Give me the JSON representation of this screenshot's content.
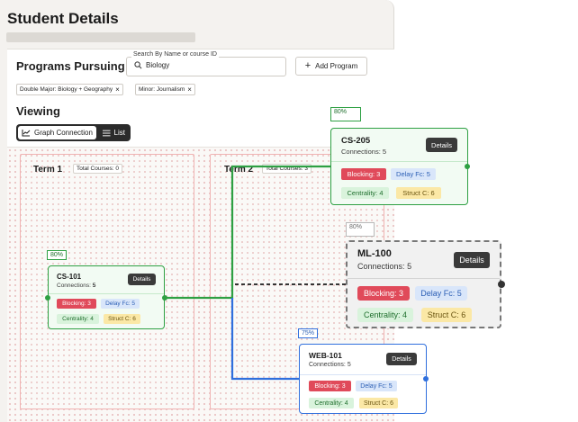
{
  "page": {
    "title": "Student Details"
  },
  "programs": {
    "title": "Programs Pursuing",
    "search": {
      "caption": "Search By Name or course ID",
      "value": "Biology",
      "placeholder": ""
    },
    "add_button": "Add Program",
    "chips": [
      "Double Major: Biology + Geography",
      "Minor: Journalism"
    ]
  },
  "viewing": {
    "title": "Viewing",
    "options": [
      "Graph Connection",
      "List"
    ],
    "selected": "Graph Connection"
  },
  "terms": [
    {
      "label": "Term 1",
      "count": "Total Courses: 0"
    },
    {
      "label": "Term 2",
      "count": "Total Courses: 3"
    }
  ],
  "courses": {
    "cs101": {
      "pct": "80%",
      "title": "CS-101",
      "connections_label": "Connections:",
      "connections": "5",
      "details": "Details",
      "tags": [
        "Blocking: 3",
        "Delay Fc: 5",
        "Centrality: 4",
        "Struct C: 6"
      ]
    },
    "cs205": {
      "pct": "80%",
      "title": "CS-205",
      "connections_label": "Connections:",
      "connections": "5",
      "details": "Details",
      "tags": [
        "Blocking: 3",
        "Delay Fc: 5",
        "Centrality: 4",
        "Struct C: 6"
      ]
    },
    "ml100": {
      "pct": "80%",
      "title": "ML-100",
      "connections_label": "Connections:",
      "connections": "5",
      "details": "Details",
      "tags": [
        "Blocking: 3",
        "Delay Fc: 5",
        "Centrality: 4",
        "Struct C: 6"
      ]
    },
    "web101": {
      "pct": "75%",
      "title": "WEB-101",
      "connections_label": "Connections:",
      "connections": "5",
      "details": "Details",
      "tags": [
        "Blocking: 3",
        "Delay Fc: 5",
        "Centrality: 4",
        "Struct C: 6"
      ]
    }
  },
  "colors": {
    "green": "#2ea043",
    "blue": "#2f6fdd",
    "dashed": "#1b1b1b",
    "accent_red": "#e04a5a"
  }
}
